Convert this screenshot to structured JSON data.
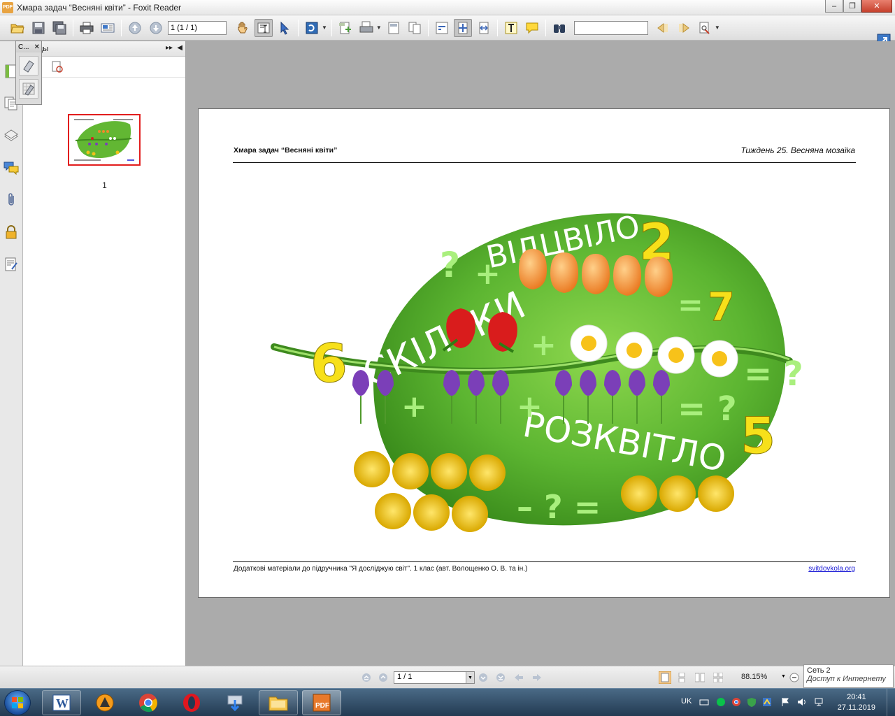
{
  "window": {
    "title": "Хмара задач “Весняні квіти” - Foxit Reader",
    "app_icon_text": "PDF"
  },
  "toolbar": {
    "page_field": "1 (1 / 1)",
    "search_value": ""
  },
  "palette": {
    "title": "С..."
  },
  "nav_panel": {
    "title": "цы",
    "thumbnail_page": "1"
  },
  "document": {
    "header_left": "Хмара задач “Весняні квіти”",
    "header_right": "Тиждень 25. Весняна мозаїка",
    "footer_left": "Додаткові матеріали до підручника \"Я досліджую світ\". 1 клас (авт. Волощенко О. В. та ін.)",
    "footer_right": "svitdovkola.org",
    "art": {
      "word_top": "ВІДЦВІЛО",
      "word_left": "СКІЛЬКИ",
      "word_bottom": "РОЗКВІТЛО",
      "num_2": "2",
      "num_6": "6",
      "num_5": "5",
      "num_7": "7",
      "q": "?",
      "plus": "+",
      "eq": "=",
      "minus": "–",
      "eq7": "= 7",
      "eqq": "= ?",
      "minusq": "– ? ="
    }
  },
  "bottom_bar": {
    "page_select": "1 / 1",
    "zoom": "88.15%"
  },
  "network_popup": {
    "line1": "Сеть  2",
    "line2": "Доступ к Интернету"
  },
  "taskbar": {
    "lang": "UK",
    "time": "20:41",
    "date": "27.11.2019"
  },
  "colors": {
    "leaf_green": "#5cb531",
    "tulip_orange": "#f08a2a",
    "crocus_purple": "#7b3fb8",
    "dandelion_yellow": "#f0c21a",
    "number_yellow": "#f7e01a"
  }
}
